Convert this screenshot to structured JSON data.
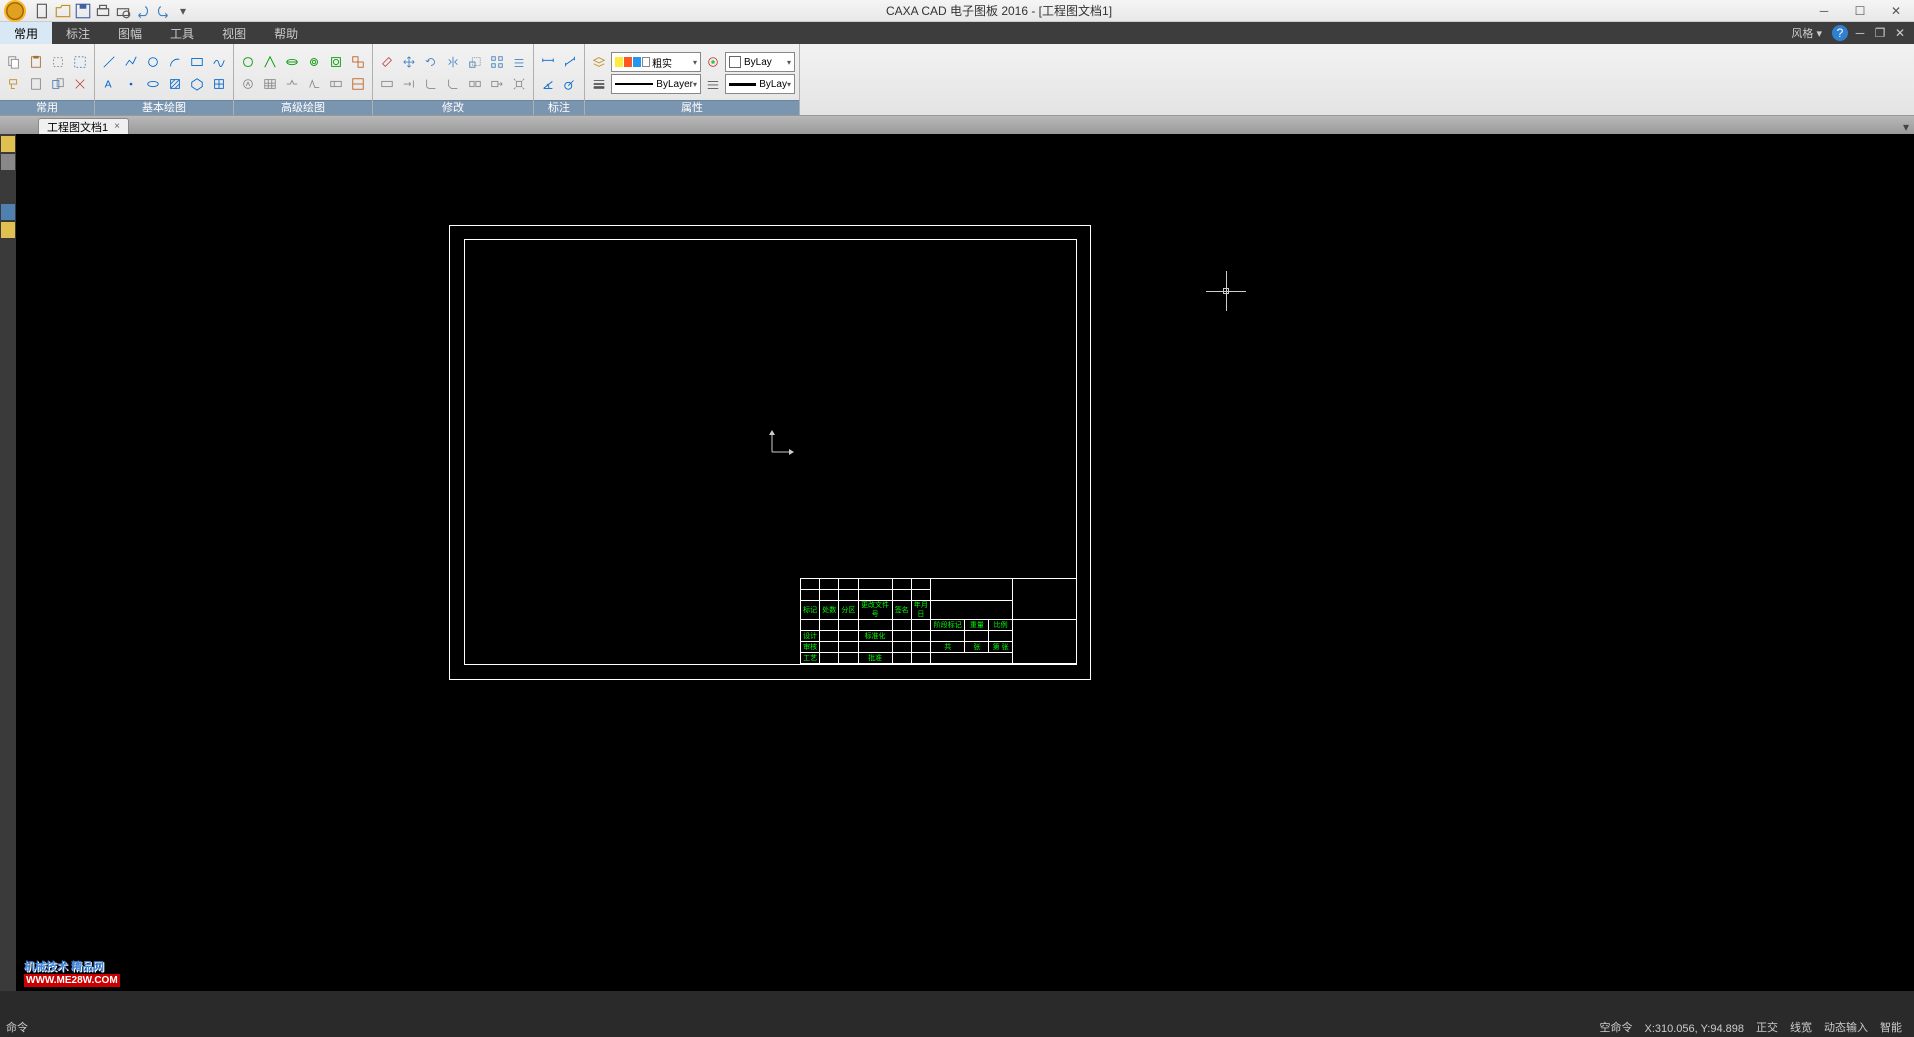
{
  "app": {
    "title": "CAXA CAD 电子图板 2016 - [工程图文档1]"
  },
  "menu": {
    "items": [
      "常用",
      "标注",
      "图幅",
      "工具",
      "视图",
      "帮助"
    ],
    "active_index": 0,
    "style_label": "风格"
  },
  "ribbon": {
    "panels": [
      "常用",
      "基本绘图",
      "高级绘图",
      "修改",
      "标注",
      "属性"
    ],
    "linetype1": "粗实",
    "bylayer": "ByLayer",
    "bylay": "ByLay"
  },
  "doc_tab": {
    "name": "工程图文档1"
  },
  "title_block": {
    "r1": [
      "标记",
      "处数",
      "分区",
      "更改文件号",
      "签名",
      "年月日",
      "",
      "",
      ""
    ],
    "r2": [
      "",
      "",
      "",
      "",
      "",
      "",
      "阶段标记",
      "重量",
      "比例"
    ],
    "r3": [
      "设计",
      "",
      "",
      "标准化",
      "",
      "",
      "",
      "",
      ""
    ],
    "r4": [
      "审核",
      "",
      "",
      "",
      "",
      "",
      "共",
      "张",
      "第",
      "张"
    ],
    "r5": [
      "工艺",
      "",
      "",
      "批准",
      "",
      "",
      "",
      "",
      ""
    ]
  },
  "status": {
    "cmd": "命令",
    "coords": "X:310.056, Y:94.898",
    "items": [
      "空命令",
      "正交",
      "线宽",
      "动态输入",
      "智能"
    ]
  },
  "watermark": {
    "line1": "机械技术 精品网",
    "line2": "WWW.ME28W.COM"
  }
}
